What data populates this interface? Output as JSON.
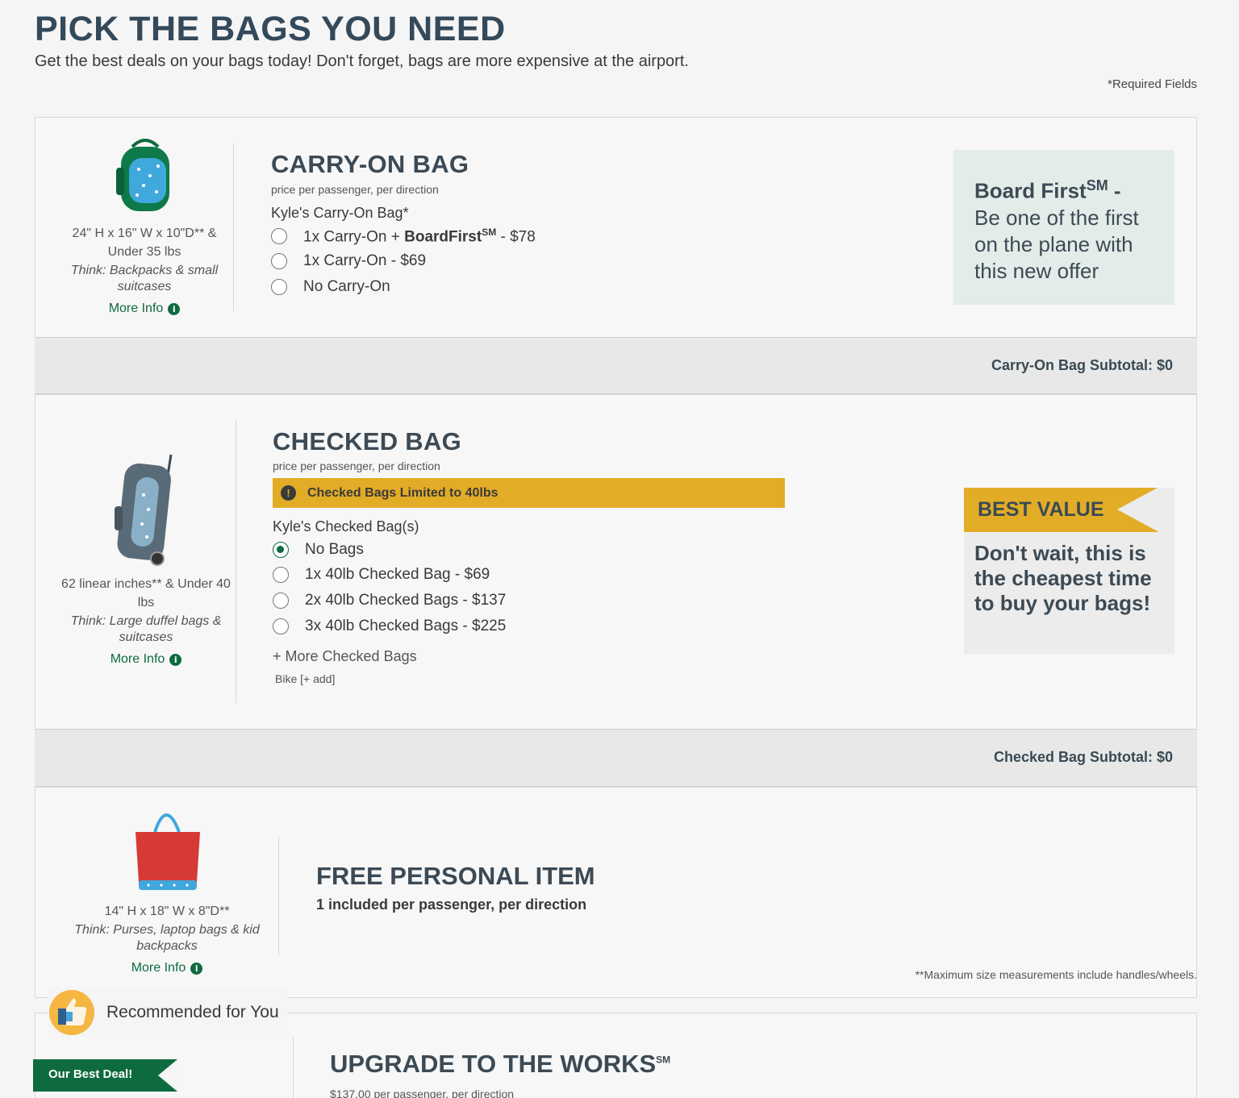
{
  "header": {
    "title": "PICK THE BAGS YOU NEED",
    "subtitle": "Get the best deals on your bags today! Don't forget, bags are more expensive at the airport.",
    "required_note": "*Required Fields"
  },
  "carry_on": {
    "dims": "24\" H x 16\" W x 10\"D** & Under 35 lbs",
    "think": "Think: Backpacks & small suitcases",
    "more_info": "More Info",
    "title": "CARRY-ON BAG",
    "price_note": "price per passenger, per direction",
    "passenger_label": "Kyle's Carry-On Bag*",
    "option1_prefix": "1x Carry-On + ",
    "option1_brand": "BoardFirst",
    "option1_sup": "SM",
    "option1_price": " - $78",
    "option2": "1x Carry-On - $69",
    "option3": "No Carry-On",
    "promo_brand": "Board First",
    "promo_sup": "SM",
    "promo_dash": " -",
    "promo_text": "Be one of the first on the plane with this new offer",
    "subtotal": "Carry-On Bag Subtotal: $0"
  },
  "checked": {
    "dims": "62 linear inches** & Under 40 lbs",
    "think": "Think: Large duffel bags & suitcases",
    "more_info": "More Info",
    "title": "CHECKED BAG",
    "price_note": "price per passenger, per direction",
    "warning": "Checked Bags Limited to 40lbs",
    "passenger_label": "Kyle's Checked Bag(s)",
    "options": [
      "No Bags",
      "1x 40lb Checked Bag - $69",
      "2x 40lb Checked Bags - $137",
      "3x 40lb Checked Bags - $225"
    ],
    "selected_option": "No Bags",
    "more_link": "+ More Checked Bags",
    "bike_link": "Bike [+ add]",
    "best_value": "BEST VALUE",
    "best_text": "Don't wait, this is the cheapest time to buy your bags!",
    "subtotal": "Checked Bag Subtotal: $0"
  },
  "personal": {
    "dims": "14\" H x 18\" W x 8\"D**",
    "think": "Think: Purses, laptop bags & kid backpacks",
    "more_info": "More Info",
    "title": "FREE PERSONAL ITEM",
    "subtitle": "1 included per passenger, per direction",
    "footnote": "**Maximum size measurements include handles/wheels."
  },
  "recommended": {
    "label": "Recommended for You",
    "deal": "Our Best Deal!",
    "title": "UPGRADE TO THE WORKS",
    "title_sup": "SM",
    "price_note": "$137.00 per passenger, per direction"
  },
  "colors": {
    "brand_green": "#0e6b3f",
    "accent_yellow": "#e3ac26",
    "heading": "#34495a",
    "promo_bg": "#e3ece8"
  },
  "icons": [
    "backpack-icon",
    "rolling-suitcase-icon",
    "tote-bag-icon",
    "info-icon",
    "warning-icon",
    "thumbs-up-icon"
  ]
}
